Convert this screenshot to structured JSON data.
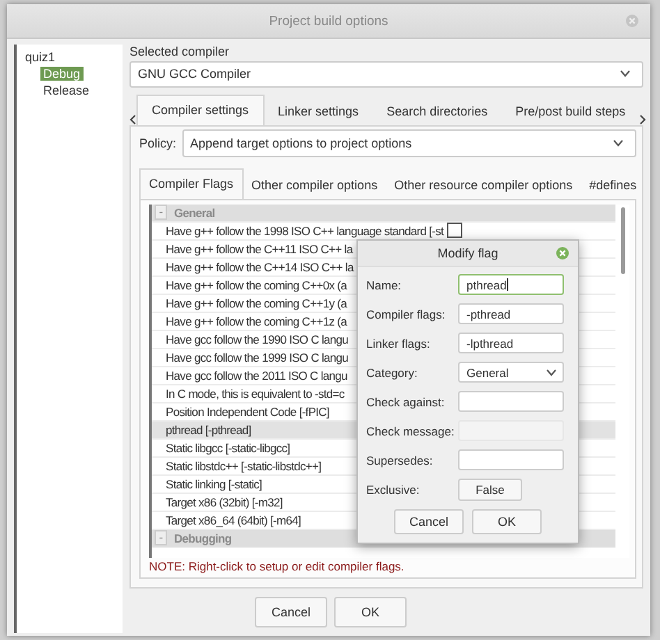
{
  "window": {
    "title": "Project build options"
  },
  "targets_tree": {
    "label": "quiz1",
    "children": [
      {
        "label": "Debug",
        "selected": true
      },
      {
        "label": "Release",
        "selected": false
      }
    ]
  },
  "selected_compiler": {
    "label": "Selected compiler",
    "value": "GNU GCC Compiler"
  },
  "tabs": [
    {
      "label": "Compiler settings",
      "selected": true
    },
    {
      "label": "Linker settings",
      "selected": false
    },
    {
      "label": "Search directories",
      "selected": false
    },
    {
      "label": "Pre/post build steps",
      "selected": false
    }
  ],
  "policy": {
    "label": "Policy:",
    "value": "Append target options to project options"
  },
  "sub_tabs": [
    {
      "label": "Compiler Flags",
      "selected": true
    },
    {
      "label": "Other compiler options",
      "selected": false
    },
    {
      "label": "Other resource compiler options",
      "selected": false
    },
    {
      "label": "#defines",
      "selected": false
    }
  ],
  "flags": [
    {
      "kind": "category",
      "expander": "-",
      "label": "General"
    },
    {
      "kind": "flag",
      "label": "Have g++ follow the 1998 ISO C++ language standard  [-st",
      "selected": false,
      "checked": false
    },
    {
      "kind": "flag",
      "label": "Have g++ follow the C++11 ISO C++ la",
      "selected": false
    },
    {
      "kind": "flag",
      "label": "Have g++ follow the C++14 ISO C++ la",
      "selected": false
    },
    {
      "kind": "flag",
      "label": "Have g++ follow the coming C++0x (a",
      "selected": false
    },
    {
      "kind": "flag",
      "label": "Have g++ follow the coming C++1y (a",
      "selected": false
    },
    {
      "kind": "flag",
      "label": "Have g++ follow the coming C++1z (a",
      "selected": false
    },
    {
      "kind": "flag",
      "label": "Have gcc follow the 1990 ISO C langu",
      "selected": false
    },
    {
      "kind": "flag",
      "label": "Have gcc follow the 1999 ISO C langu",
      "selected": false
    },
    {
      "kind": "flag",
      "label": "Have gcc follow the 2011 ISO C langu",
      "selected": false
    },
    {
      "kind": "flag",
      "label": "In C mode, this is equivalent to -std=c",
      "selected": false
    },
    {
      "kind": "flag",
      "label": "Position Independent Code  [-fPIC]",
      "selected": false
    },
    {
      "kind": "flag",
      "label": "pthread  [-pthread]",
      "selected": true
    },
    {
      "kind": "flag",
      "label": "Static libgcc  [-static-libgcc]",
      "selected": false
    },
    {
      "kind": "flag",
      "label": "Static libstdc++  [-static-libstdc++]",
      "selected": false
    },
    {
      "kind": "flag",
      "label": "Static linking  [-static]",
      "selected": false
    },
    {
      "kind": "flag",
      "label": "Target x86 (32bit)  [-m32]",
      "selected": false
    },
    {
      "kind": "flag",
      "label": "Target x86_64 (64bit)  [-m64]",
      "selected": false
    },
    {
      "kind": "category",
      "expander": "-",
      "label": "Debugging"
    }
  ],
  "note": "NOTE: Right-click to setup or edit compiler flags.",
  "modify_flag": {
    "title": "Modify flag",
    "fields": [
      {
        "kind": "text",
        "label": "Name:",
        "value": "pthread",
        "focused": true,
        "disabled": false
      },
      {
        "kind": "text",
        "label": "Compiler flags:",
        "value": "-pthread",
        "focused": false,
        "disabled": false
      },
      {
        "kind": "text",
        "label": "Linker flags:",
        "value": "-lpthread",
        "focused": false,
        "disabled": false
      },
      {
        "kind": "combo",
        "label": "Category:",
        "value": "General"
      },
      {
        "kind": "text",
        "label": "Check against:",
        "focused": false,
        "disabled": false
      },
      {
        "kind": "text",
        "label": "Check message:",
        "focused": false,
        "disabled": true
      },
      {
        "kind": "text",
        "label": "Supersedes:",
        "focused": false,
        "disabled": false
      },
      {
        "kind": "toggle",
        "label": "Exclusive:",
        "value": "False"
      }
    ],
    "buttons": [
      "Cancel",
      "OK"
    ]
  },
  "buttons": [
    "Cancel",
    "OK"
  ]
}
